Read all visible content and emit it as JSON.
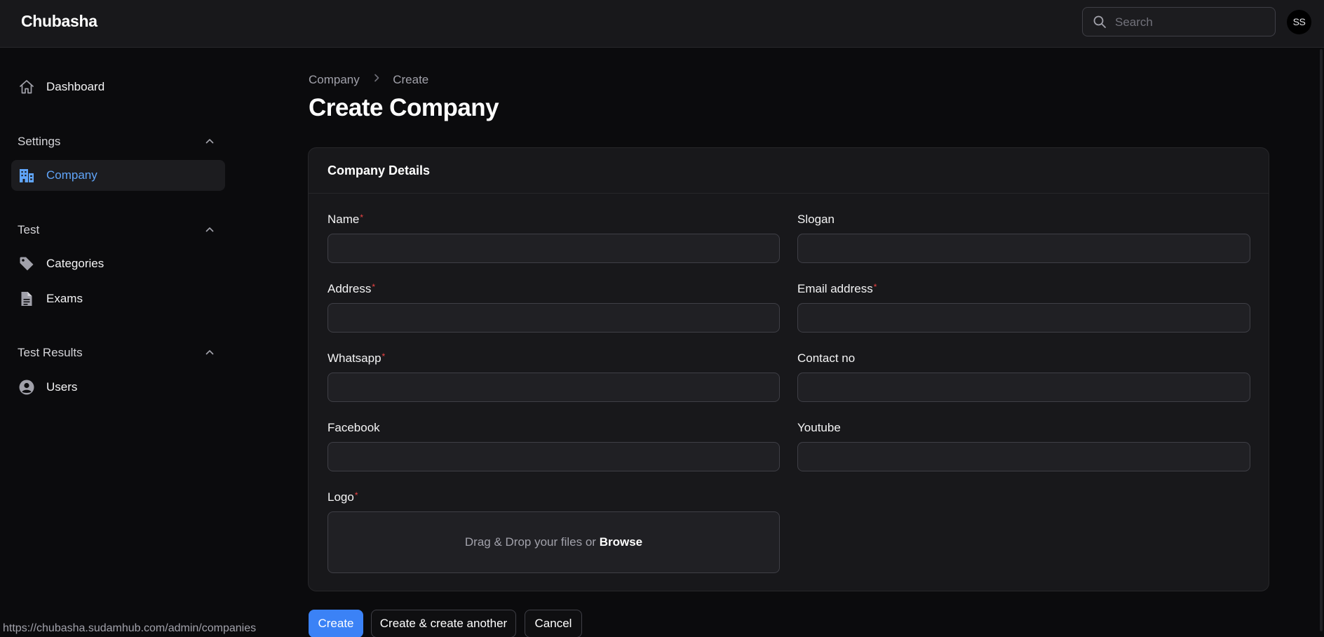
{
  "app": {
    "brand": "Chubasha"
  },
  "search": {
    "placeholder": "Search"
  },
  "user": {
    "initials": "SS"
  },
  "sidebar": {
    "dashboard": "Dashboard",
    "groups": [
      {
        "label": "Settings",
        "items": [
          {
            "label": "Company",
            "icon": "building-icon",
            "active": true
          }
        ]
      },
      {
        "label": "Test",
        "items": [
          {
            "label": "Categories",
            "icon": "tag-icon"
          },
          {
            "label": "Exams",
            "icon": "document-icon"
          }
        ]
      },
      {
        "label": "Test Results",
        "items": [
          {
            "label": "Users",
            "icon": "user-circle-icon"
          }
        ]
      }
    ]
  },
  "breadcrumb": {
    "parent": "Company",
    "current": "Create"
  },
  "page": {
    "title": "Create Company"
  },
  "form": {
    "section_title": "Company Details",
    "fields": {
      "name": {
        "label": "Name",
        "required": true,
        "value": ""
      },
      "slogan": {
        "label": "Slogan",
        "required": false,
        "value": ""
      },
      "address": {
        "label": "Address",
        "required": true,
        "value": ""
      },
      "email": {
        "label": "Email address",
        "required": true,
        "value": ""
      },
      "whatsapp": {
        "label": "Whatsapp",
        "required": true,
        "value": ""
      },
      "contact": {
        "label": "Contact no",
        "required": false,
        "value": ""
      },
      "facebook": {
        "label": "Facebook",
        "required": false,
        "value": ""
      },
      "youtube": {
        "label": "Youtube",
        "required": false,
        "value": ""
      },
      "logo": {
        "label": "Logo",
        "required": true
      }
    },
    "dropzone": {
      "text": "Drag & Drop your files or",
      "browse": "Browse"
    },
    "required_marker": "*"
  },
  "actions": {
    "create": "Create",
    "create_another": "Create & create another",
    "cancel": "Cancel"
  },
  "status_bar": {
    "url": "https://chubasha.sudamhub.com/admin/companies"
  },
  "colors": {
    "accent": "#3b82f6",
    "active_nav": "#60a5fa",
    "required": "#ef4444",
    "background": "#0b0b0d",
    "surface": "#18181b"
  }
}
